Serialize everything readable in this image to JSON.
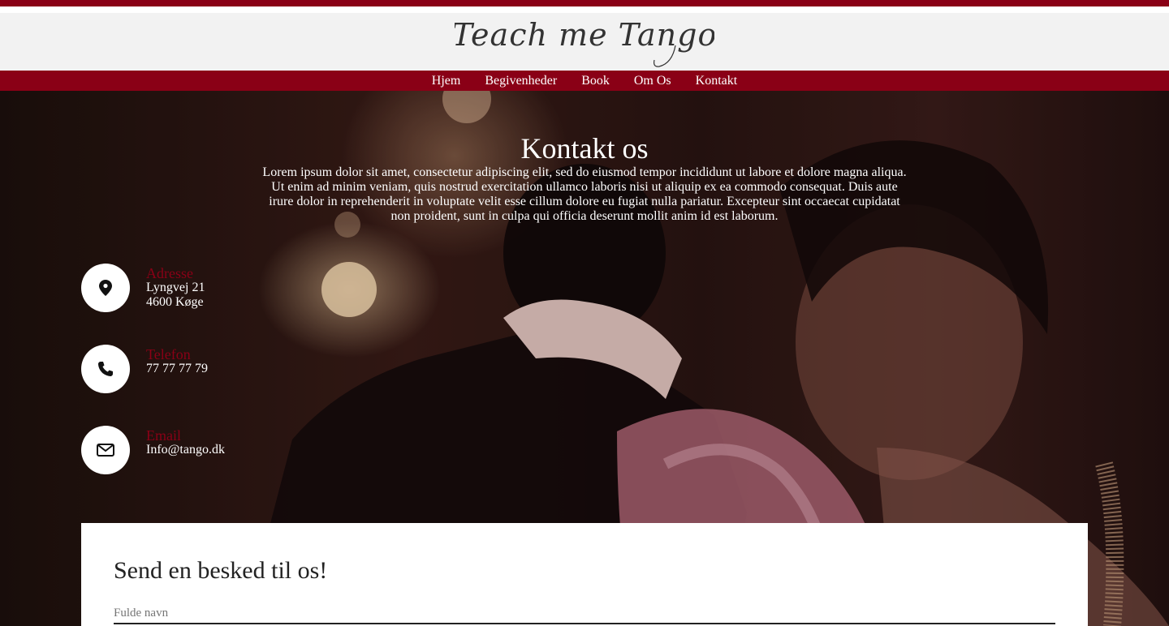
{
  "brand": {
    "logo_text": "Teach me Tango"
  },
  "nav": {
    "items": [
      {
        "label": "Hjem"
      },
      {
        "label": "Begivenheder"
      },
      {
        "label": "Book"
      },
      {
        "label": "Om Os"
      },
      {
        "label": "Kontakt"
      }
    ]
  },
  "hero": {
    "title": "Kontakt os",
    "intro": "Lorem ipsum dolor sit amet, consectetur adipiscing elit, sed do eiusmod tempor incididunt ut labore et dolore magna aliqua. Ut enim ad minim veniam, quis nostrud exercitation ullamco laboris nisi ut aliquip ex ea commodo consequat. Duis aute irure dolor in reprehenderit in voluptate velit esse cillum dolore eu fugiat nulla pariatur. Excepteur sint occaecat cupidatat non proident, sunt in culpa qui officia deserunt mollit anim id est laborum."
  },
  "contact": {
    "address": {
      "label": "Adresse",
      "line1": "Lyngvej 21",
      "line2": "4600 Køge",
      "icon": "map-pin-icon"
    },
    "phone": {
      "label": "Telefon",
      "value": "77 77 77 79",
      "icon": "phone-icon"
    },
    "email": {
      "label": "Email",
      "value": "Info@tango.dk",
      "icon": "envelope-icon"
    }
  },
  "form": {
    "title": "Send en besked til os!",
    "name_field": {
      "placeholder": "Fulde navn",
      "value": ""
    }
  },
  "colors": {
    "accent": "#8a0016",
    "header_bg": "#f2f2f2",
    "text_light": "#ffffff"
  }
}
